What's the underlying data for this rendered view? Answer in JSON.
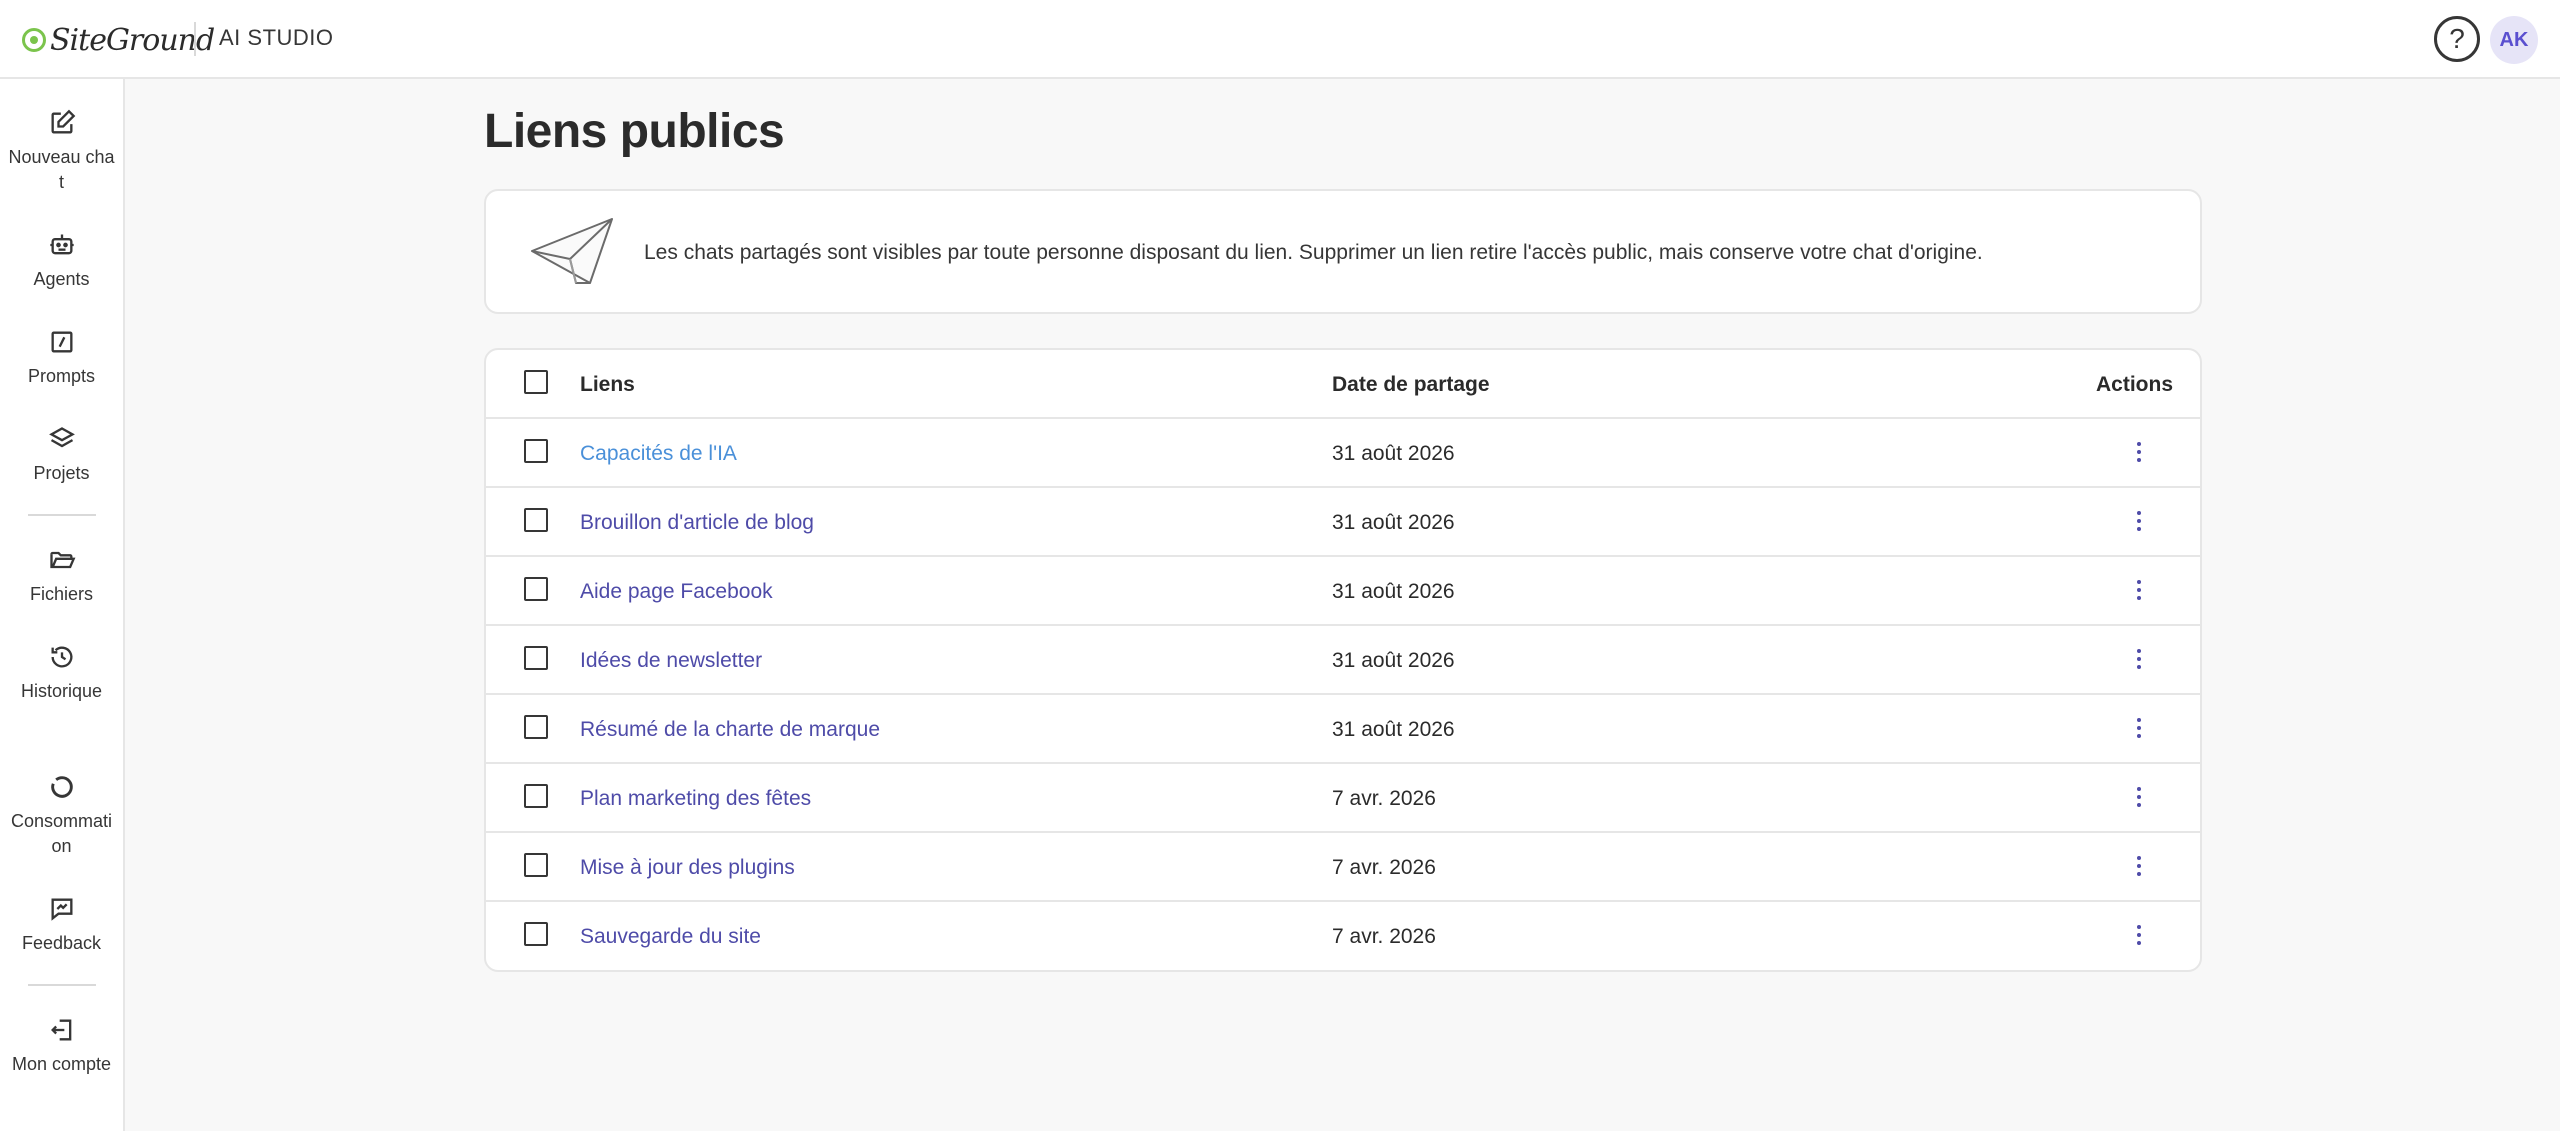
{
  "header": {
    "logo_text": "SiteGround",
    "app_name": "AI STUDIO",
    "help_label": "?",
    "avatar_initials": "AK"
  },
  "sidebar": {
    "items": [
      {
        "label": "Nouveau chat",
        "icon": "edit-icon"
      },
      {
        "label": "Agents",
        "icon": "robot-icon"
      },
      {
        "label": "Prompts",
        "icon": "prompt-icon"
      },
      {
        "label": "Projets",
        "icon": "layers-icon"
      },
      {
        "label": "Fichiers",
        "icon": "folder-icon"
      },
      {
        "label": "Historique",
        "icon": "history-icon"
      },
      {
        "label": "Consommation",
        "icon": "usage-icon"
      },
      {
        "label": "Feedback",
        "icon": "feedback-icon"
      },
      {
        "label": "Mon compte",
        "icon": "logout-icon"
      }
    ]
  },
  "page": {
    "title": "Liens publics",
    "info": "Les chats partagés sont visibles par toute personne disposant du lien. Supprimer un lien retire l'accès public, mais conserve votre chat d'origine."
  },
  "table": {
    "headers": {
      "links": "Liens",
      "date": "Date de partage",
      "actions": "Actions"
    },
    "rows": [
      {
        "link": "Capacités de l'IA",
        "date": "31 août 2026"
      },
      {
        "link": "Brouillon d'article de blog",
        "date": "31 août 2026"
      },
      {
        "link": "Aide page Facebook",
        "date": "31 août 2026"
      },
      {
        "link": "Idées de newsletter",
        "date": "31 août 2026"
      },
      {
        "link": "Résumé de la charte de marque",
        "date": "31 août 2026"
      },
      {
        "link": "Plan marketing des fêtes",
        "date": "7 avr. 2026"
      },
      {
        "link": "Mise à jour des plugins",
        "date": "7 avr. 2026"
      },
      {
        "link": "Sauvegarde du site",
        "date": "7 avr. 2026"
      }
    ]
  },
  "colors": {
    "accent": "#4e4ba8",
    "brand_green": "#7bc44c",
    "avatar_bg": "#e6e4f7"
  }
}
